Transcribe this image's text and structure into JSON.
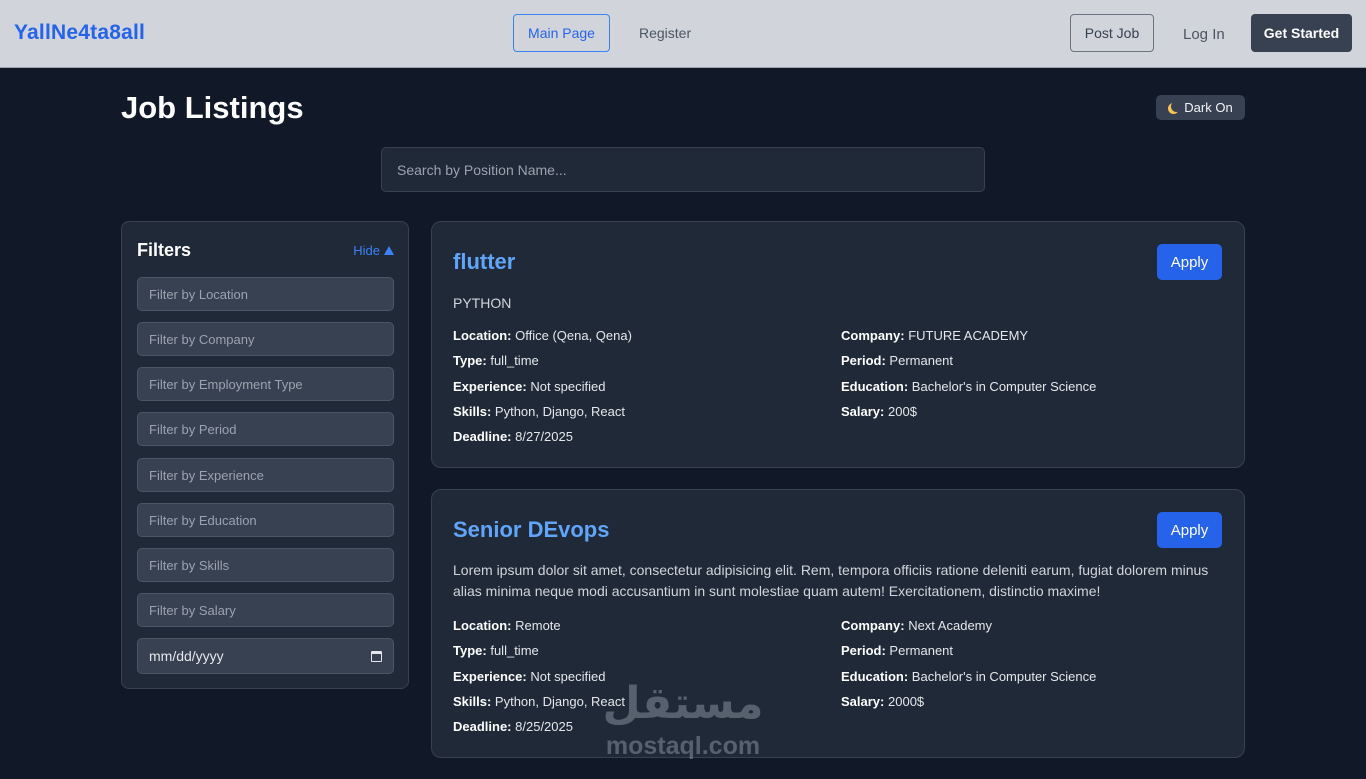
{
  "navbar": {
    "brand": "YallNe4ta8all",
    "main_page": "Main Page",
    "register": "Register",
    "post_job": "Post Job",
    "log_in": "Log In",
    "get_started": "Get Started"
  },
  "header": {
    "title": "Job Listings",
    "dark_toggle": "Dark On"
  },
  "search": {
    "placeholder": "Search by Position Name..."
  },
  "filters": {
    "title": "Filters",
    "hide_label": "Hide",
    "fields": [
      {
        "placeholder": "Filter by Location"
      },
      {
        "placeholder": "Filter by Company"
      },
      {
        "placeholder": "Filter by Employment Type"
      },
      {
        "placeholder": "Filter by Period"
      },
      {
        "placeholder": "Filter by Experience"
      },
      {
        "placeholder": "Filter by Education"
      },
      {
        "placeholder": "Filter by Skills"
      },
      {
        "placeholder": "Filter by Salary"
      }
    ],
    "date_placeholder": "mm/dd/yyyy"
  },
  "jobs": [
    {
      "title": "flutter",
      "apply": "Apply",
      "description": "PYTHON",
      "location_label": "Location:",
      "location": "Office (Qena, Qena)",
      "type_label": "Type:",
      "type": "full_time",
      "experience_label": "Experience:",
      "experience": "Not specified",
      "skills_label": "Skills:",
      "skills": "Python, Django, React",
      "deadline_label": "Deadline:",
      "deadline": "8/27/2025",
      "company_label": "Company:",
      "company": "FUTURE ACADEMY",
      "period_label": "Period:",
      "period": "Permanent",
      "education_label": "Education:",
      "education": "Bachelor's in Computer Science",
      "salary_label": "Salary:",
      "salary": "200$"
    },
    {
      "title": "Senior DEvops",
      "apply": "Apply",
      "description": "Lorem ipsum dolor sit amet, consectetur adipisicing elit. Rem, tempora officiis ratione deleniti earum, fugiat dolorem minus alias minima neque modi accusantium in sunt molestiae quam autem! Exercitationem, distinctio maxime!",
      "location_label": "Location:",
      "location": "Remote",
      "type_label": "Type:",
      "type": "full_time",
      "experience_label": "Experience:",
      "experience": "Not specified",
      "skills_label": "Skills:",
      "skills": "Python, Django, React",
      "deadline_label": "Deadline:",
      "deadline": "8/25/2025",
      "company_label": "Company:",
      "company": "Next Academy",
      "period_label": "Period:",
      "period": "Permanent",
      "education_label": "Education:",
      "education": "Bachelor's in Computer Science",
      "salary_label": "Salary:",
      "salary": "2000$"
    }
  ],
  "watermark": {
    "arabic": "مستقل",
    "latin": "mostaql.com"
  },
  "colors": {
    "background": "#111827",
    "card": "#1f2937",
    "accent": "#2563eb",
    "link": "#60a5fa",
    "navbar": "#d1d5db"
  }
}
